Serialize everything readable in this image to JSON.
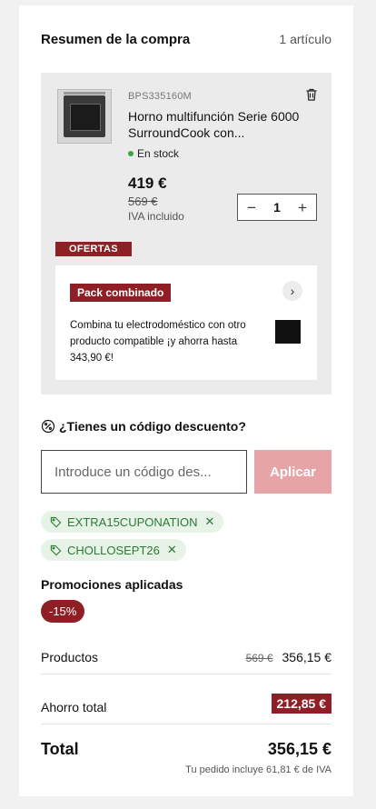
{
  "summary": {
    "title": "Resumen de la compra",
    "item_count": "1 artículo"
  },
  "product": {
    "sku": "BPS335160M",
    "name": "Horno multifunción Serie 6000 SurroundCook con...",
    "stock": "En stock",
    "price": "419 €",
    "old_price": "569 €",
    "tax_note": "IVA incluido",
    "quantity": "1",
    "minus": "−",
    "plus": "+",
    "offer_badge": "OFERTAS",
    "pack": {
      "badge": "Pack combinado",
      "arrow": "›",
      "text": "Combina tu electrodoméstico con otro producto compatible ¡y ahorra hasta 343,90 €!"
    }
  },
  "discount": {
    "title": "¿Tienes un código descuento?",
    "icon": "percent-icon",
    "placeholder": "Introduce un código des...",
    "apply_label": "Aplicar",
    "coupons": [
      {
        "code": "EXTRA15CUPONATION",
        "remove": "✕"
      },
      {
        "code": "CHOLLOSEPT26",
        "remove": "✕"
      }
    ]
  },
  "promotions": {
    "title": "Promociones aplicadas",
    "badge": "-15%"
  },
  "totals": {
    "products_label": "Productos",
    "products_old": "569 €",
    "products_value": "356,15 €",
    "savings_label": "Ahorro total",
    "savings_value": "212,85 €",
    "total_label": "Total",
    "total_value": "356,15 €",
    "tax_included": "Tu pedido incluye 61,81 € de IVA"
  },
  "colors": {
    "accent": "#8f1f24",
    "apply_disabled": "#e6a4a7",
    "coupon_green": "#2d7a36",
    "stock_green": "#3aa447"
  }
}
